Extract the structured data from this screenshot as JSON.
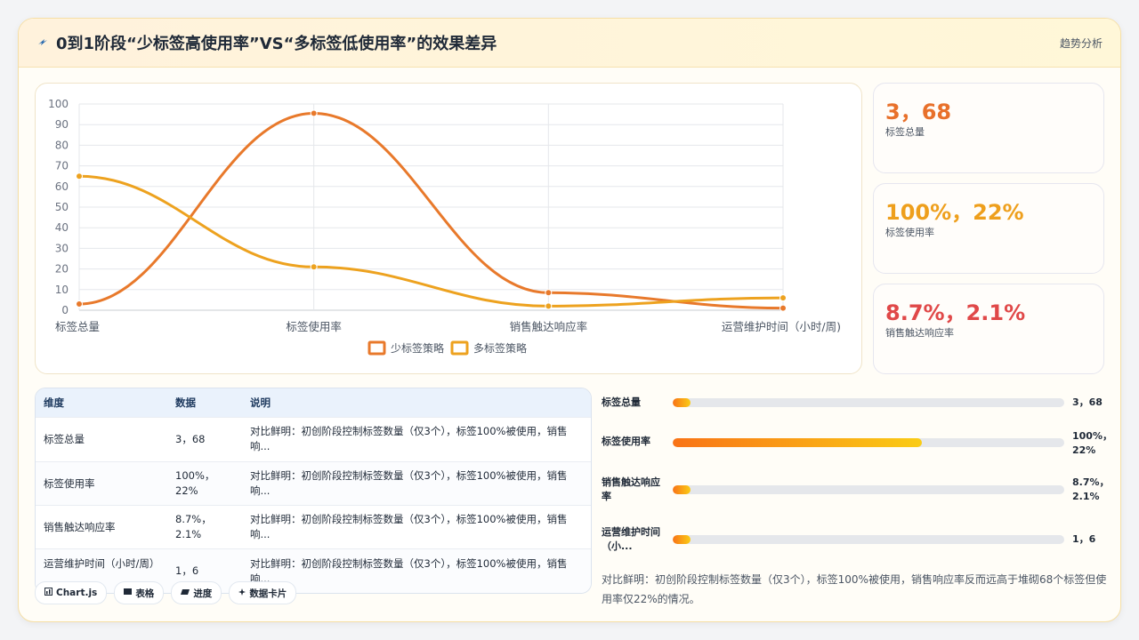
{
  "header": {
    "icon": "lightning-icon",
    "title": "0到1阶段“少标签高使用率”VS“多标签低使用率”的效果差异",
    "right_label": "趋势分析"
  },
  "chart_data": {
    "type": "line",
    "categories": [
      "标签总量",
      "标签使用率",
      "销售触达响应率",
      "运营维护时间（小时/周)"
    ],
    "series": [
      {
        "name": "少标签策略",
        "color": "#e8792b",
        "values": [
          3,
          95.5,
          8.5,
          1
        ]
      },
      {
        "name": "多标签策略",
        "color": "#eda21f",
        "values": [
          65,
          21,
          2,
          6
        ]
      }
    ],
    "yticks": [
      "0",
      "10",
      "20",
      "30",
      "40",
      "50",
      "60",
      "70",
      "80",
      "90",
      "100"
    ],
    "ylim": [
      0,
      100
    ],
    "grid": true,
    "legend": "bottom"
  },
  "stats": [
    {
      "value": "3，68",
      "label": "标签总量",
      "color": "#e8702a"
    },
    {
      "value": "100%，22%",
      "label": "标签使用率",
      "color": "#ee9f1c"
    },
    {
      "value": "8.7%，2.1%",
      "label": "销售触达响应率",
      "color": "#e04848"
    }
  ],
  "table": {
    "headers": [
      "维度",
      "数据",
      "说明"
    ],
    "rows": [
      {
        "dim": "标签总量",
        "data": "3，68",
        "desc": "对比鲜明：初创阶段控制标签数量（仅3个），标签100%被使用，销售响..."
      },
      {
        "dim": "标签使用率",
        "data": "100%，22%",
        "desc": "对比鲜明：初创阶段控制标签数量（仅3个），标签100%被使用，销售响..."
      },
      {
        "dim": "销售触达响应率",
        "data": "8.7%，2.1%",
        "desc": "对比鲜明：初创阶段控制标签数量（仅3个），标签100%被使用，销售响..."
      },
      {
        "dim": "运营维护时间（小时/周）",
        "data": "1，6",
        "desc": "对比鲜明：初创阶段控制标签数量（仅3个），标签100%被使用，销售响..."
      }
    ]
  },
  "tags": [
    {
      "icon": "chart-icon",
      "label": "Chart.js"
    },
    {
      "icon": "table-icon",
      "label": "表格"
    },
    {
      "icon": "progress-icon",
      "label": "进度"
    },
    {
      "icon": "card-icon",
      "label": "数据卡片"
    }
  ],
  "bars": [
    {
      "label": "标签总量",
      "value": "3，68",
      "progress": 0.045
    },
    {
      "label": "标签使用率",
      "value": "100%，22%",
      "progress": 0.636
    },
    {
      "label": "销售触达响应率",
      "value": "8.7%，2.1%",
      "progress": 0.045
    },
    {
      "label": "运营维护时间（小...",
      "value": "1，6",
      "progress": 0.045
    }
  ],
  "summary": "对比鲜明：初创阶段控制标签数量（仅3个），标签100%被使用，销售响应率反而远高于堆砌68个标签但使用率仅22%的情况。"
}
